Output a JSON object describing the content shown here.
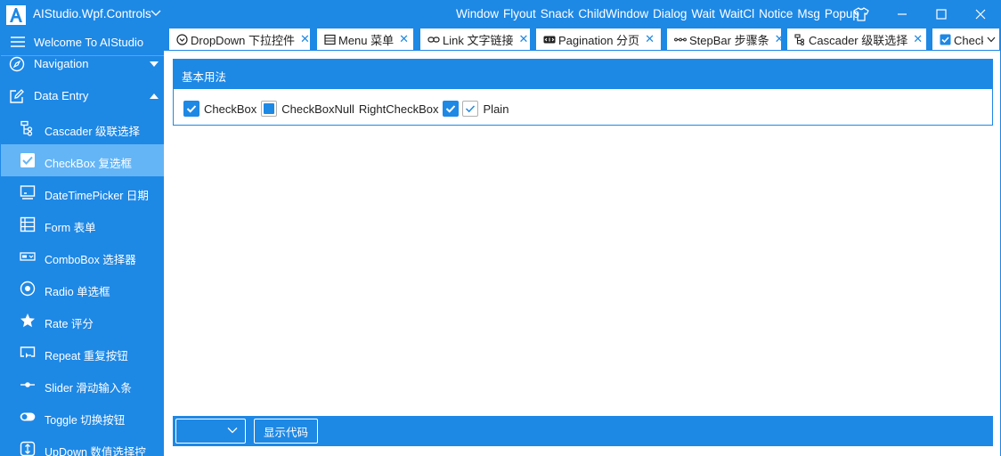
{
  "app": {
    "title": "AIStudio.Wpf.Controls",
    "menu": [
      "Window",
      "Flyout",
      "Snack",
      "ChildWindow",
      "Dialog",
      "Wait",
      "WaitCl",
      "Notice",
      "Msg",
      "Popup"
    ]
  },
  "sidebar": {
    "welcome": "Welcome To AIStudio",
    "navigation": "Navigation",
    "data_entry": "Data Entry",
    "items": [
      {
        "label": "Cascader 级联选择",
        "icon": "cascader-icon"
      },
      {
        "label": "CheckBox 复选框",
        "icon": "checkbox-icon",
        "active": true
      },
      {
        "label": "DateTimePicker 日期",
        "icon": "datetimepicker-icon"
      },
      {
        "label": "Form 表单",
        "icon": "form-icon"
      },
      {
        "label": "ComboBox 选择器",
        "icon": "combobox-icon"
      },
      {
        "label": "Radio 单选框",
        "icon": "radio-icon"
      },
      {
        "label": "Rate 评分",
        "icon": "star-icon"
      },
      {
        "label": "Repeat 重复按钮",
        "icon": "repeat-icon"
      },
      {
        "label": "Slider 滑动输入条",
        "icon": "slider-icon"
      },
      {
        "label": "Toggle 切换按钮",
        "icon": "toggle-icon"
      },
      {
        "label": "UpDown 数值选择控",
        "icon": "updown-icon"
      }
    ]
  },
  "tabs": [
    {
      "label": "DropDown 下拉控件",
      "icon": "dropdown-icon"
    },
    {
      "label": "Menu 菜单",
      "icon": "menu-icon"
    },
    {
      "label": "Link 文字链接",
      "icon": "link-icon"
    },
    {
      "label": "Pagination 分页",
      "icon": "pagination-icon"
    },
    {
      "label": "StepBar 步骤条",
      "icon": "stepbar-icon"
    },
    {
      "label": "Cascader 级联选择",
      "icon": "cascader-icon"
    },
    {
      "label": "CheckBox 复选框",
      "icon": "checkbox-icon",
      "active": true
    }
  ],
  "demo": {
    "header": "基本用法",
    "checkboxes": [
      {
        "label": "CheckBox",
        "state": "checked"
      },
      {
        "label": "CheckBoxNull",
        "state": "null"
      },
      {
        "label": "RightCheckBox",
        "state": "checked"
      },
      {
        "label": "Plain",
        "state": "plain"
      }
    ]
  },
  "bottom": {
    "combo_value": "",
    "show_code": "显示代码"
  },
  "colors": {
    "accent": "#1e88e5",
    "active_item": "#64b5f6"
  }
}
